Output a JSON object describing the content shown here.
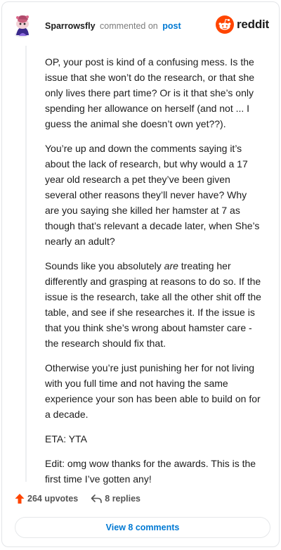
{
  "comment": {
    "username": "Sparrowsfly",
    "action": "commented on",
    "target": "post",
    "brand": "reddit",
    "paragraphs": [
      {
        "text": "OP, your post is kind of a confusing mess. Is the issue that she won’t do the research, or that she only lives there part time? Or is it that she’s only spending her allowance on herself (and not ... I guess the animal she doesn’t own yet??)."
      },
      {
        "text": "You’re up and down the comments saying it’s about the lack of research, but why would a 17 year old research a pet they’ve been given several other reasons they’ll never have? Why are you saying she killed her hamster at 7 as though that’s relevant a decade later, when She’s nearly an adult?"
      },
      {
        "before": "Sounds like you absolutely ",
        "emph": "are",
        "after": " treating her differently and grasping at reasons to do so. If the issue is the research, take all the other shit off the table, and see if she researches it. If the issue is that you think she’s wrong about hamster care - the research should fix that."
      },
      {
        "text": "Otherwise you’re just punishing her for not living with you full time and not having the same experience your son has been able to build on for a decade."
      },
      {
        "text": "ETA: YTA"
      },
      {
        "text": "Edit: omg wow thanks for the awards. This is the first time I’ve gotten any!"
      }
    ],
    "upvotes": "264 upvotes",
    "replies": "8 replies",
    "view_button": "View 8 comments"
  },
  "colors": {
    "accent_orange": "#ff4500",
    "link_blue": "#0079d3",
    "thread_line": "#edeff1"
  },
  "icons": {
    "avatar": "snoo-avatar-icon",
    "brand": "reddit-logo-icon",
    "upvote": "upvote-arrow-icon",
    "reply": "reply-arrow-icon"
  }
}
